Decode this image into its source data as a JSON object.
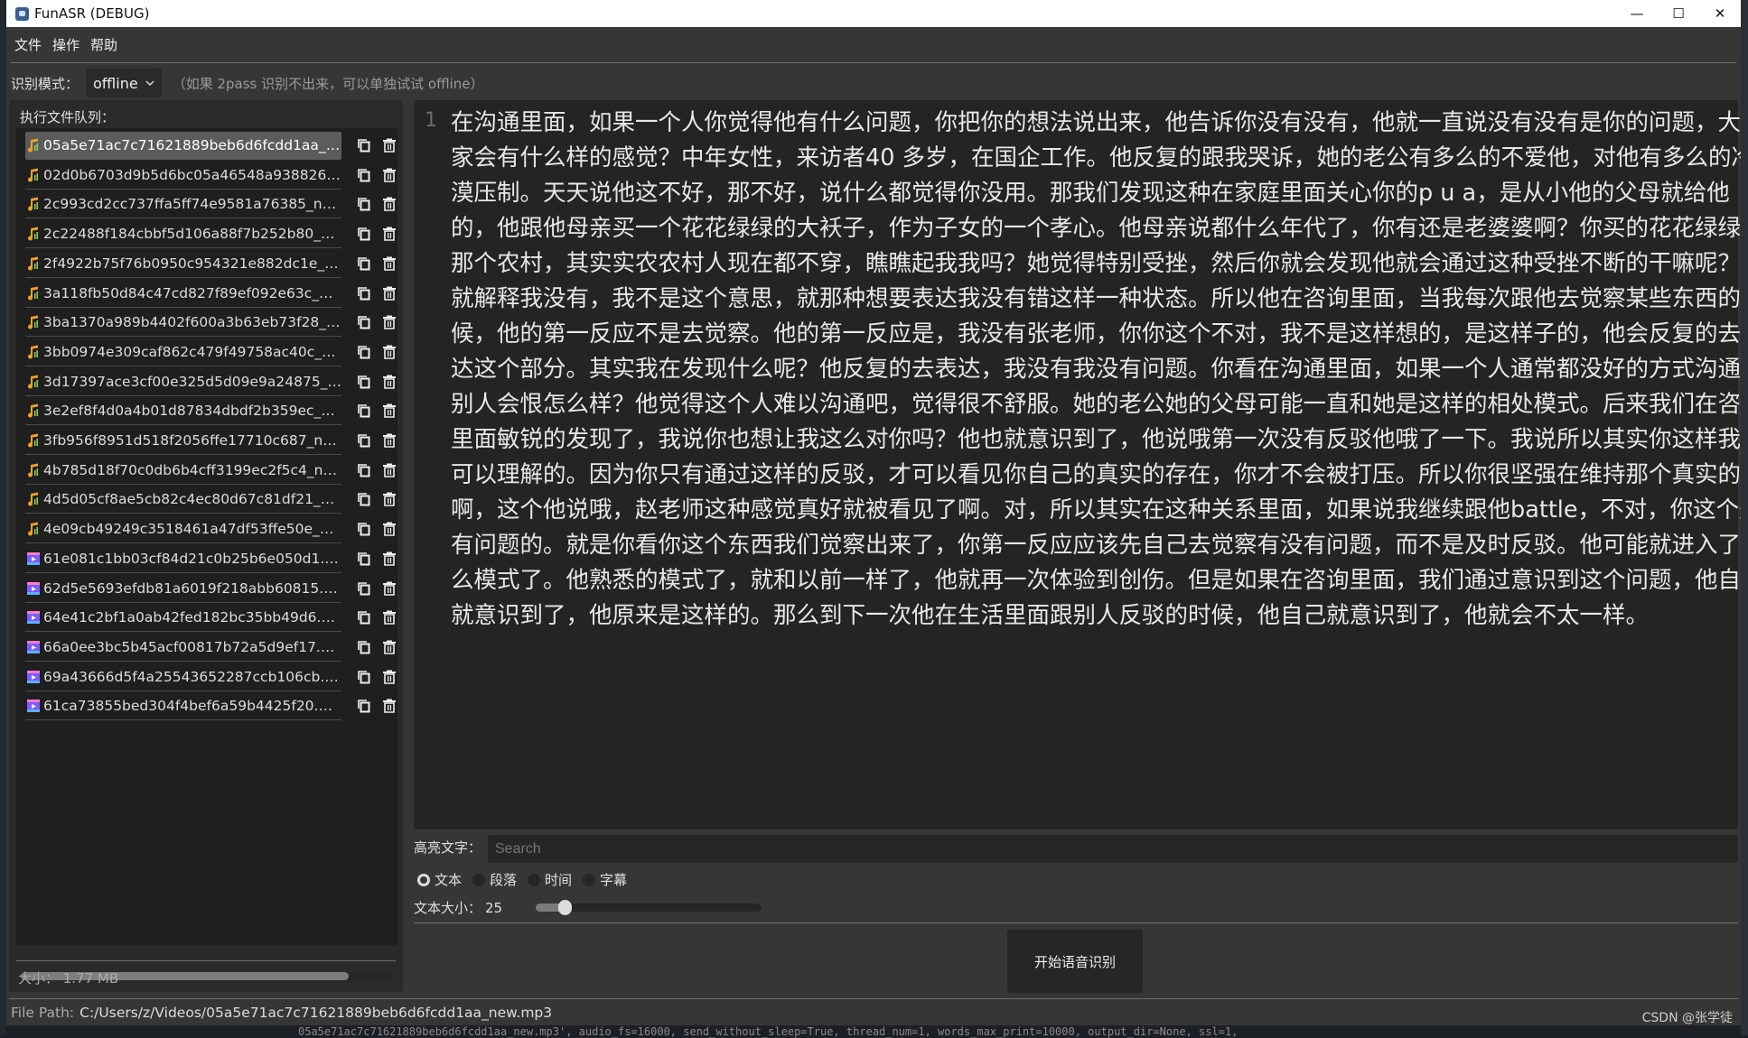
{
  "window": {
    "title": "FunASR (DEBUG)",
    "controls": [
      "minimize",
      "maximize",
      "close"
    ]
  },
  "menu": {
    "items": [
      "文件",
      "操作",
      "帮助"
    ]
  },
  "mode": {
    "label": "识别模式：",
    "value": "offline",
    "hint": "（如果 2pass 识别不出来，可以单独试试 offline）"
  },
  "queue": {
    "title": "执行文件队列：",
    "selected_index": 0,
    "files": [
      {
        "name": "05a5e71ac7c71621889beb6d6fcdd1aa_ne...",
        "type": "audio"
      },
      {
        "name": "02d0b6703d9b5d6bc05a46548a938826_n...",
        "type": "audio"
      },
      {
        "name": "2c993cd2cc737ffa5ff74e9581a76385_new...",
        "type": "audio"
      },
      {
        "name": "2c22488f184cbbf5d106a88f7b252b80_ne...",
        "type": "audio"
      },
      {
        "name": "2f4922b75f76b0950c954321e882dc1e_ne...",
        "type": "audio"
      },
      {
        "name": "3a118fb50d84c47cd827f89ef092e63c_ne...",
        "type": "audio"
      },
      {
        "name": "3ba1370a989b4402f600a3b63eb73f28_ne...",
        "type": "audio"
      },
      {
        "name": "3bb0974e309caf862c479f49758ac40c_ne...",
        "type": "audio"
      },
      {
        "name": "3d17397ace3cf00e325d5d09e9a24875_ne...",
        "type": "audio"
      },
      {
        "name": "3e2ef8f4d0a4b01d87834dbdf2b359ec_ne...",
        "type": "audio"
      },
      {
        "name": "3fb956f8951d518f2056ffe17710c687_new...",
        "type": "audio"
      },
      {
        "name": "4b785d18f70c0db6b4cff3199ec2f5c4_ne...",
        "type": "audio"
      },
      {
        "name": "4d5d05cf8ae5cb82c4ec80d67c81df21_ne...",
        "type": "audio"
      },
      {
        "name": "4e09cb49249c3518461a47df53ffe50e_ne...",
        "type": "audio"
      },
      {
        "name": "61e081c1bb03cf84d21c0b25b6e050d1.mp4",
        "type": "video"
      },
      {
        "name": "62d5e5693efdb81a6019f218abb60815.mp4",
        "type": "video"
      },
      {
        "name": "64e41c2bf1a0ab42fed182bc35bb49d6.mp4",
        "type": "video"
      },
      {
        "name": "66a0ee3bc5b45acf00817b72a5d9ef17.mp4",
        "type": "video"
      },
      {
        "name": "69a43666d5f4a25543652287ccb106cb.mp4",
        "type": "video"
      },
      {
        "name": "61ca73855bed304f4bef6a59b4425f20.mp4",
        "type": "video"
      }
    ],
    "row_icons": [
      "copy-icon",
      "trash-icon"
    ],
    "size": "大小：  1.77 MB"
  },
  "transcript": {
    "line_number": "1",
    "lines": [
      "在沟通里面，如果一个人你觉得他有什么问题，你把你的想法说出来，他告诉你没有没有，他就一直说没有没有是你的问题，大",
      "家会有什么样的感觉？中年女性，来访者40 多岁，在国企工作。他反复的跟我哭诉，她的老公有多么的不爱他，对他有多么的冷",
      "漠压制。天天说他这不好，那不好，说什么都觉得你没用。那我们发现这种在家庭里面关心你的p u a，是从小他的父母就给他",
      "的，他跟他母亲买一个花花绿绿的大袄子，作为子女的一个孝心。他母亲说都什么年代了，你有还是老婆婆啊？你买的花花绿绿的",
      "那个农村，其实实农农村人现在都不穿，瞧瞧起我我吗？她觉得特别受挫，然后你就会发现他就会通过这种受挫不断的干嘛呢？",
      "就解释我没有，我不是这个意思，就那种想要表达我没有错这样一种状态。所以他在咨询里面，当我每次跟他去觉察某些东西的时",
      "候，他的第一反应不是去觉察。他的第一反应是，我没有张老师，你你这个不对，我不是这样想的，是这样子的，他会反复的去表",
      "达这个部分。其实我在发现什么呢？他反复的去表达，我没有我没有问题。你看在沟通里面，如果一个人通常都没好的方式沟通，",
      "别人会恨怎么样？他觉得这个人难以沟通吧，觉得很不舒服。她的老公她的父母可能一直和她是这样的相处模式。后来我们在咨询",
      "里面敏锐的发现了，我说你也想让我这么对你吗？他也就意识到了，他说哦第一次没有反驳他哦了一下。我说所以其实你这样我是",
      "可以理解的。因为你只有通过这样的反驳，才可以看见你自己的真实的存在，你才不会被打压。所以你很坚强在维持那个真实的你",
      "啊，这个他说哦，赵老师这种感觉真好就被看见了啊。对，所以其实在这种关系里面，如果说我继续跟他battle，不对，你这个是",
      "有问题的。就是你看你这个东西我们觉察出来了，你第一反应应该先自己去觉察有没有问题，而不是及时反驳。他可能就进入了什",
      "么模式了。他熟悉的模式了，就和以前一样了，他就再一次体验到创伤。但是如果在咨询里面，我们通过意识到这个问题，他自己",
      "就意识到了，他原来是这样的。那么到下一次他在生活里面跟别人反驳的时候，他自己就意识到了，他就会不太一样。"
    ]
  },
  "highlight": {
    "label": "高亮文字：",
    "placeholder": "Search",
    "value": ""
  },
  "view_modes": {
    "options": [
      "文本",
      "段落",
      "时间",
      "字幕"
    ],
    "selected": "文本"
  },
  "font_size": {
    "label": "文本大小：",
    "value": "25",
    "slider_fraction": 0.1
  },
  "start_button": "开始语音识别",
  "file_path": {
    "label": "File Path:",
    "value": "C:/Users/z/Videos/05a5e71ac7c71621889beb6d6fcdd1aa_new.mp3"
  },
  "background": {
    "terminal_text": "05a5e71ac7c71621889beb6d6fcdd1aa_new.mp3', audio_fs=16000, send_without_sleep=True, thread_num=1, words_max_print=10000, output_dir=None, ssl=1,"
  },
  "watermark": "CSDN @张学徒",
  "colors": {
    "window_bg": "#363636",
    "panel_bg": "#2a2a2a",
    "editor_bg": "#242424",
    "selected_row": "#5c5c5c",
    "audio_icon": "#f0a030",
    "video_icon": "#7a5cff"
  }
}
